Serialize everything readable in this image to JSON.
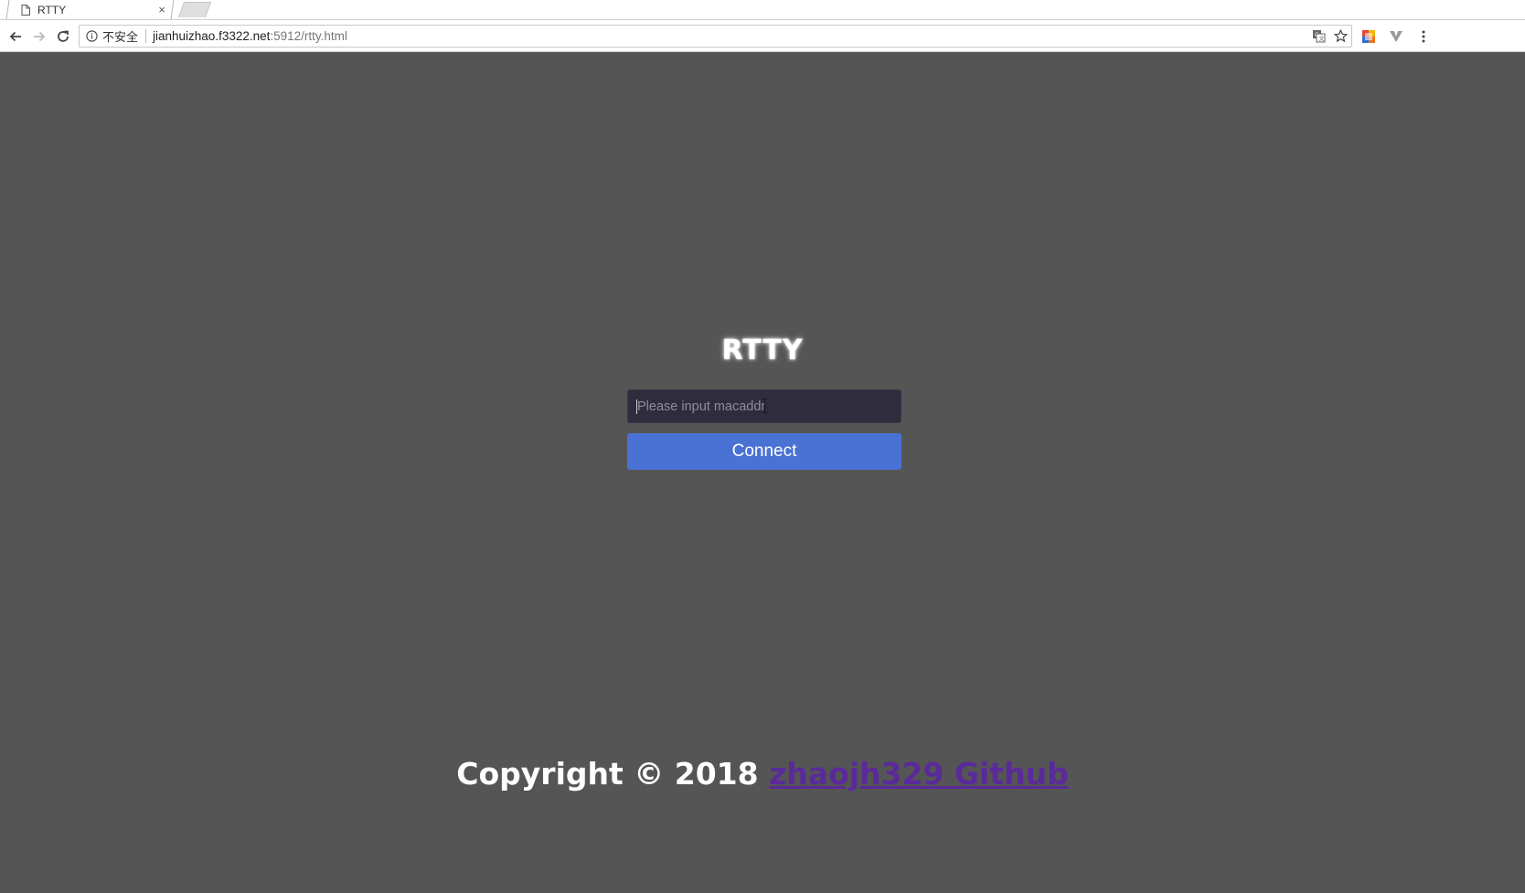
{
  "browser": {
    "tab": {
      "title": "RTTY",
      "close_glyph": "×",
      "page_icon": "document-icon"
    },
    "toolbar": {
      "back_icon": "back-arrow-icon",
      "forward_icon": "forward-arrow-icon",
      "reload_icon": "reload-icon",
      "security_label": "不安全",
      "url_host": "jianhuizhao.f3322.net",
      "url_path": ":5912/rtty.html",
      "omnibox_icons": [
        "translate-icon",
        "bookmark-star-icon"
      ],
      "extension_icons": [
        "extension-color-icon",
        "vivaldi-v-icon"
      ],
      "menu_icon": "kebab-menu-icon"
    }
  },
  "page": {
    "title": "RTTY",
    "input": {
      "placeholder": "Please input macaddr",
      "value": ""
    },
    "connect_label": "Connect",
    "footer": {
      "copyright_text": "Copyright © 2018 ",
      "link_text": "zhaojh329 Github"
    }
  },
  "colors": {
    "page_background": "#555555",
    "input_background": "#2f2d3d",
    "button_background": "#4a72d4",
    "link_color": "#5a2a9a",
    "text_color": "#ffffff"
  }
}
